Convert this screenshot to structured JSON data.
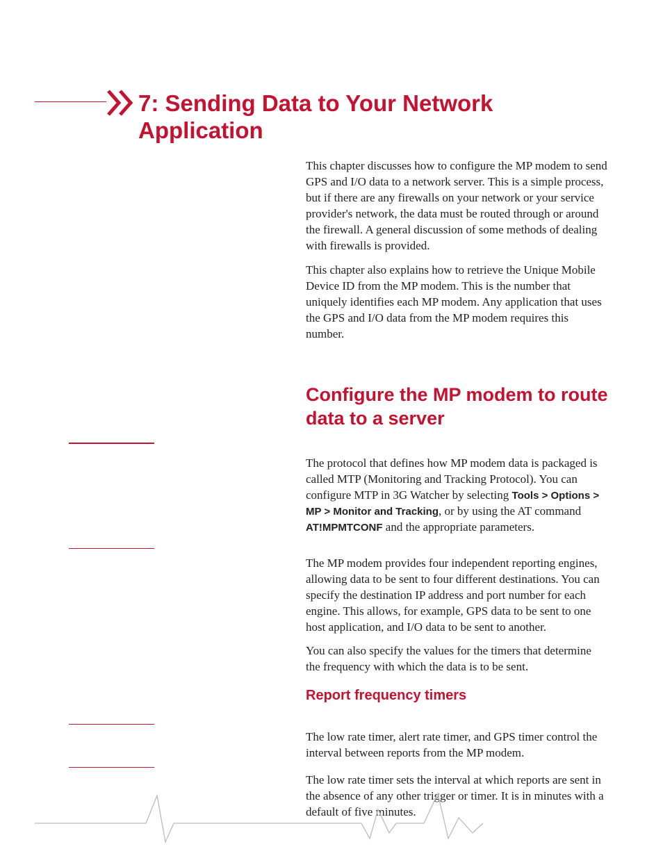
{
  "chapter": {
    "number": "7",
    "title": "7: Sending Data to Your Network Application"
  },
  "paragraphs": {
    "p1": "This chapter discusses how to configure the MP modem to send GPS and I/O data to a network server. This is a simple process, but if there are any firewalls on your network or your service provider's network, the data must be routed through or around the firewall. A general discussion of some methods of dealing with firewalls is provided.",
    "p2": "This chapter also explains how to retrieve the Unique Mobile Device ID from the MP modem. This is the number that uniquely identifies each MP modem. Any application that uses the GPS and I/O data from the MP modem requires this number.",
    "p3_pre": "The protocol that defines how MP modem data is packaged is called MTP (Monitoring and Tracking Protocol). You can configure MTP in 3G Watcher by selecting ",
    "p3_bold1": "Tools > Options > MP > Monitor and Tracking",
    "p3_mid": ", or by using the AT command ",
    "p3_bold2": "AT!MPMTCONF",
    "p3_post": " and the appropriate parameters.",
    "p4": "The MP modem provides four independent reporting engines, allowing data to be sent to four different destinations. You can specify the destination IP address and port number for each engine. This allows, for example, GPS data to be sent to one host application, and I/O data to be sent to another.",
    "p5": "You can also specify the values for the timers that determine the frequency with which the data is to be sent.",
    "p6": "The low rate timer, alert rate timer, and GPS timer control the interval between reports from the MP modem.",
    "p7": "The low rate timer sets the interval at which reports are sent in the absence of any other trigger or timer. It is in minutes with a default of five minutes."
  },
  "headings": {
    "h2": "Configure the MP modem to route data to a server",
    "h3": "Report frequency timers"
  },
  "colors": {
    "accent": "#c41230"
  }
}
